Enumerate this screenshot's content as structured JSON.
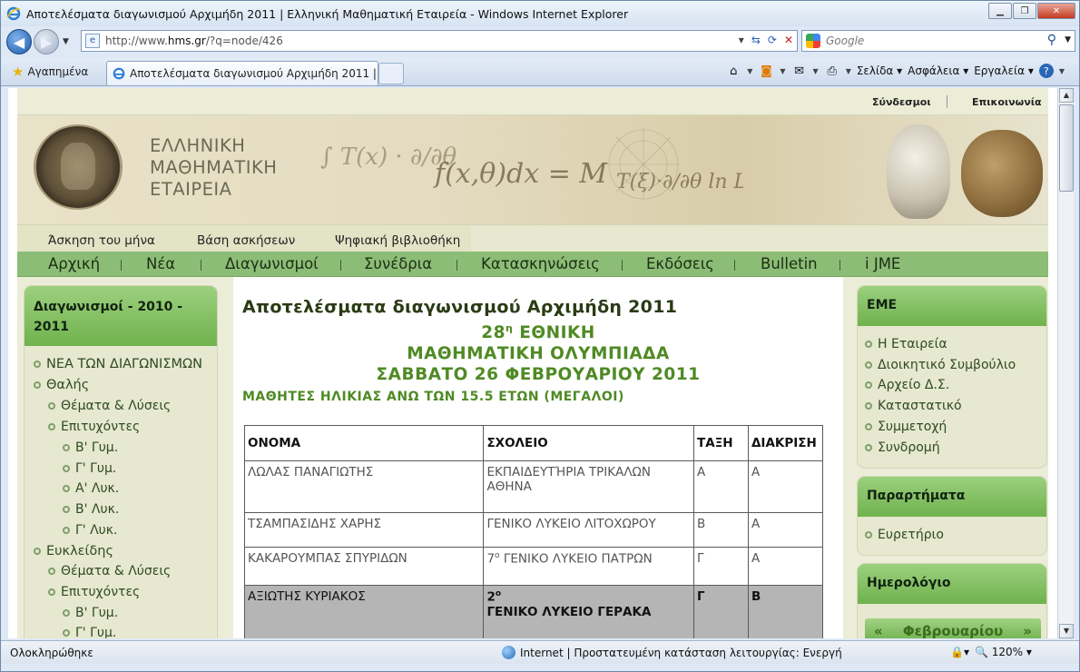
{
  "window": {
    "title": "Αποτελέσματα διαγωνισμού Αρχιμήδη 2011 | Ελληνική Μαθηματική Εταιρεία - Windows Internet Explorer"
  },
  "address": {
    "url_prefix": "http://www.",
    "url_host": "hms.gr",
    "url_suffix": "/?q=node/426"
  },
  "search": {
    "placeholder": "Google"
  },
  "tabbar": {
    "favorites": "Αγαπημένα",
    "tab_title": "Αποτελέσματα διαγωνισμού Αρχιμήδη 2011 | Ελ..."
  },
  "commandbar": {
    "page": "Σελίδα",
    "safety": "Ασφάλεια",
    "tools": "Εργαλεία"
  },
  "status": {
    "left": "Ολοκληρώθηκε",
    "zone": "Internet | Προστατευμένη κατάσταση λειτουργίας: Ενεργή",
    "zoom": "120%"
  },
  "site": {
    "topnav": [
      "Σύνδεσμοι",
      "Επικοινωνία"
    ],
    "logo_lines": [
      "ΕΛΛΗΝΙΚΗ",
      "ΜΑΘΗΜΑΤΙΚΗ",
      "ΕΤΑΙΡΕΙΑ"
    ],
    "subnav": [
      "Άσκηση του μήνα",
      "Βάση ασκήσεων",
      "Ψηφιακή βιβλιοθήκη"
    ],
    "mainnav": [
      "Αρχική",
      "Νέα",
      "Διαγωνισμοί",
      "Συνέδρια",
      "Κατασκηνώσεις",
      "Εκδόσεις",
      "Bulletin",
      "i JME"
    ],
    "left_sidebar": {
      "title": "Διαγωνισμοί - 2010 - 2011",
      "items": [
        "ΝΕΑ ΤΩΝ ΔΙΑΓΩΝΙΣΜΩΝ",
        "Θαλής",
        "Θέματα & Λύσεις",
        "Επιτυχόντες",
        "Β' Γυμ.",
        "Γ' Γυμ.",
        "Α' Λυκ.",
        "Β' Λυκ.",
        "Γ' Λυκ.",
        "Ευκλείδης",
        "Θέματα & Λύσεις",
        "Επιτυχόντες",
        "Β' Γυμ.",
        "Γ' Γυμ."
      ]
    },
    "content": {
      "title": "Αποτελέσματα διαγωνισμού Αρχιμήδη 2011",
      "line1_prefix": "28",
      "line1_sup": "η",
      "line1_suffix": " ΕΘΝΙΚΗ",
      "line2": "ΜΑΘΗΜΑΤΙΚΗ ΟΛΥΜΠΙΑΔΑ",
      "line3": "ΣΑΒΒΑΤΟ 26 ΦΕΒΡΟΥΑΡΙΟΥ 2011",
      "grade": "ΜΑΘΗΤΕΣ ΗΛΙΚΙΑΣ ΑΝΩ ΤΩΝ 15.5 ΕΤΩΝ (ΜΕΓΑΛΟΙ)",
      "table": {
        "headers": [
          "ΟΝΟΜΑ",
          "ΣΧΟΛΕΙΟ",
          "ΤΑΞΗ",
          "ΔΙΑΚΡΙΣΗ"
        ],
        "rows": [
          [
            "ΛΩΛΑΣ ΠΑΝΑΓΙΩΤΗΣ",
            "ΕΚΠΑΙΔΕΥΤΉΡΙΑ ΤΡΙΚΑΛΩΝ ΑΘΗΝΑ",
            "Α",
            "Α"
          ],
          [
            "ΤΣΑΜΠΑΣΙΔΗΣ ΧΑΡΗΣ",
            "ΓΕΝΙΚΟ ΛΥΚΕΙΟ ΛΙΤΟΧΩΡΟΥ",
            "Β",
            "Α"
          ],
          [
            "ΚΑΚΑΡΟΥΜΠΑΣ ΣΠΥΡΙΔΩΝ",
            "7ο ΓΕΝΙΚΟ ΛΥΚΕΙΟ ΠΑΤΡΩΝ",
            "Γ",
            "Α"
          ],
          [
            "ΑΞΙΩΤΗΣ ΚΥΡΙΑΚΟΣ",
            "2ο",
            "Γ",
            "Β"
          ]
        ],
        "row3_school_num": "7",
        "row3_school_sup": "ο",
        "row3_school_rest": " ΓΕΝΙΚΟ ΛΥΚΕΙΟ ΠΑΤΡΩΝ",
        "row4_school_num": "2",
        "row4_school_sup": "ο",
        "row4_school_line2": "ΓΕΝΙΚΟ ΛΥΚΕΙΟ ΓΕΡΑΚΑ"
      }
    },
    "right_sidebar": {
      "eme_title": "ΕΜΕ",
      "eme_items": [
        "Η Εταιρεία",
        "Διοικητικό Συμβούλιο",
        "Αρχείο Δ.Σ.",
        "Καταστατικό",
        "Συμμετοχή",
        "Συνδρομή"
      ],
      "branches_title": "Παραρτήματα",
      "branches_items": [
        "Ευρετήριο"
      ],
      "calendar_title": "Ημερολόγιο",
      "calendar_month": "Φεβρουαρίου",
      "calendar_prev": "«",
      "calendar_next": "»"
    }
  }
}
